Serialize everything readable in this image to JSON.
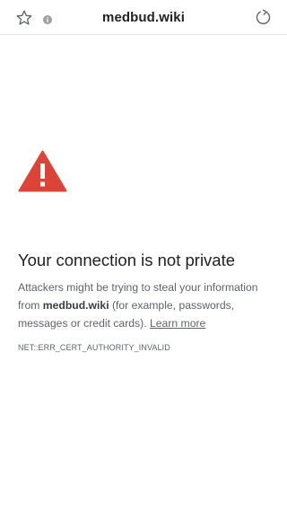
{
  "toolbar": {
    "url": "medbud.wiki",
    "bookmark_icon": "star-outline-icon",
    "info_icon": "info-circle-icon",
    "reload_icon": "reload-icon"
  },
  "interstitial": {
    "icon": "warning-triangle-icon",
    "icon_color": "#d93025",
    "heading": "Your connection is not private",
    "body_prefix": "Attackers might be trying to steal your information from ",
    "domain": "medbud.wiki",
    "body_suffix": " (for example, passwords, messages or credit cards). ",
    "learn_more": "Learn more",
    "error_code": "NET::ERR_CERT_AUTHORITY_INVALID"
  }
}
